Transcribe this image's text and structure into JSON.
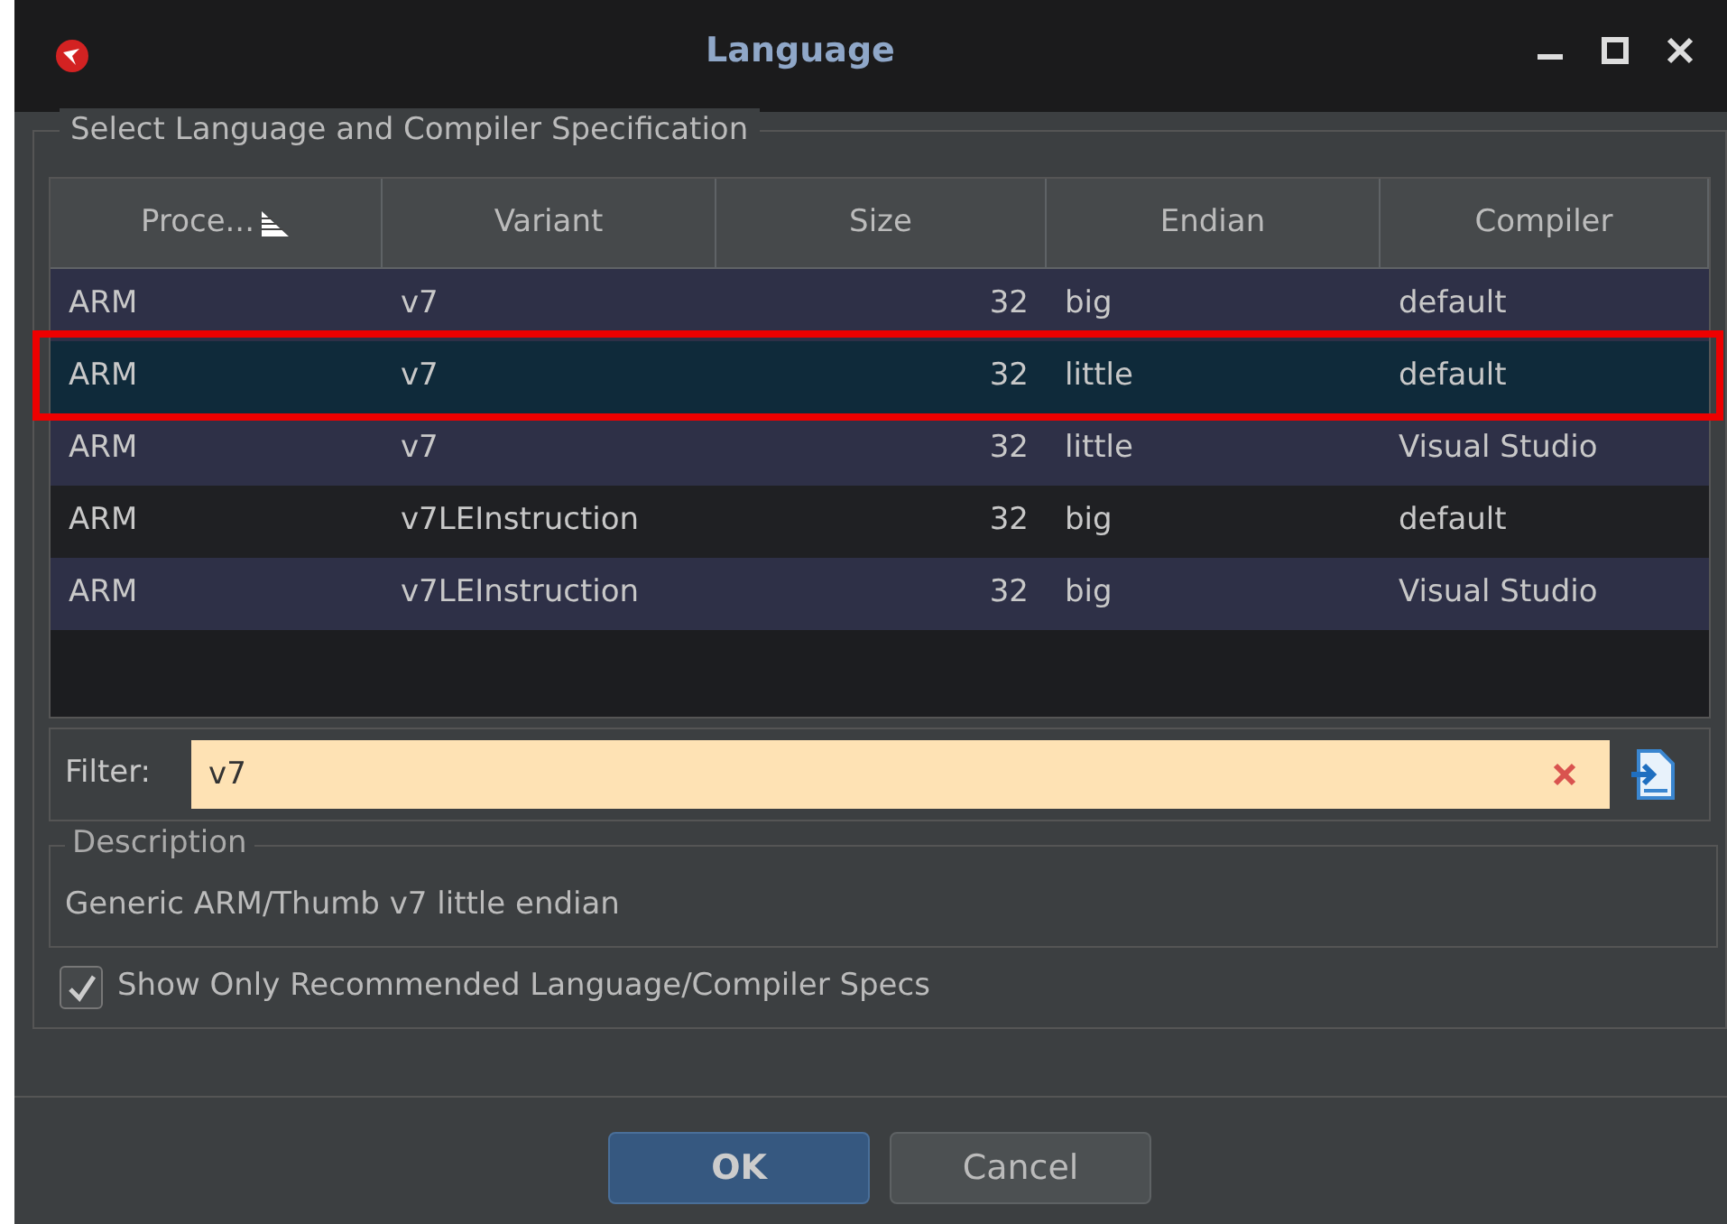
{
  "window": {
    "title": "Language"
  },
  "group": {
    "title": "Select Language and Compiler Specification"
  },
  "table": {
    "columns": [
      {
        "label": "Proce...",
        "sorted": true
      },
      {
        "label": "Variant",
        "sorted": false
      },
      {
        "label": "Size",
        "sorted": false
      },
      {
        "label": "Endian",
        "sorted": false
      },
      {
        "label": "Compiler",
        "sorted": false
      }
    ],
    "rows": [
      {
        "cells": [
          "ARM",
          "v7",
          "32",
          "big",
          "default"
        ],
        "selected": false,
        "highlighted": false
      },
      {
        "cells": [
          "ARM",
          "v7",
          "32",
          "little",
          "default"
        ],
        "selected": true,
        "highlighted": true
      },
      {
        "cells": [
          "ARM",
          "v7",
          "32",
          "little",
          "Visual Studio"
        ],
        "selected": false,
        "highlighted": false
      },
      {
        "cells": [
          "ARM",
          "v7LEInstruction",
          "32",
          "big",
          "default"
        ],
        "selected": false,
        "highlighted": false
      },
      {
        "cells": [
          "ARM",
          "v7LEInstruction",
          "32",
          "big",
          "Visual Studio"
        ],
        "selected": false,
        "highlighted": false
      }
    ]
  },
  "filter": {
    "label": "Filter:",
    "value": "v7"
  },
  "description": {
    "title": "Description",
    "text": "Generic ARM/Thumb v7 little endian"
  },
  "recommended": {
    "label": "Show Only Recommended Language/Compiler Specs",
    "checked": true
  },
  "buttons": [
    {
      "label": "OK",
      "kind": "primary"
    },
    {
      "label": "Cancel",
      "kind": "secondary"
    }
  ]
}
